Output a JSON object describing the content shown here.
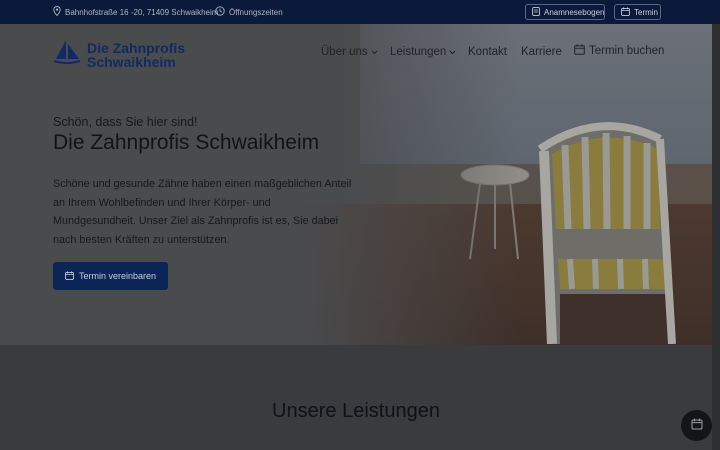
{
  "topbar": {
    "address": "Bahnhofstraße 16 -20, 71409 Schwaikheim",
    "hours": "Öffnungszeiten",
    "anamnese_label": "Anamnesebogen",
    "termin_label": "Termin"
  },
  "brand": {
    "line1": "Die Zahnprofis",
    "line2": "Schwaikheim"
  },
  "nav": {
    "items": [
      {
        "label": "Über uns"
      },
      {
        "label": "Leistungen"
      },
      {
        "label": "Kontakt"
      },
      {
        "label": "Karriere"
      },
      {
        "label": "Termin buchen"
      }
    ]
  },
  "hero": {
    "subtitle": "Schön, dass Sie hier sind!",
    "title": "Die Zahnprofis Schwaikheim",
    "text": "Schöne und gesunde Zähne haben einen maßgeblichen Anteil an Ihrem Wohlbefinden und Ihrer Körper- und Mundgesundheit. Unser Ziel als Zahnprofis ist es, Sie dabei nach besten Kräften zu unterstützen.",
    "cta_label": "Termin vereinbaren"
  },
  "services": {
    "title": "Unsere Leistungen"
  },
  "colors": {
    "topbar": "#0b1a3a",
    "brand": "#102a66",
    "cta": "#0c2557"
  }
}
